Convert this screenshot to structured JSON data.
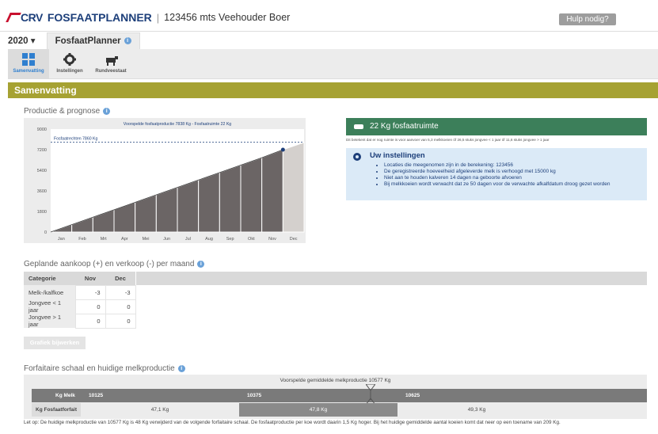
{
  "header": {
    "brand": "CRV",
    "app_name": "FOSFAATPLANNER",
    "separator": "|",
    "customer": "123456  mts Veehouder Boer",
    "help_button": "Hulp nodig?"
  },
  "yearbar": {
    "year": "2020 ▾",
    "tab": "FosfaatPlanner"
  },
  "toolbar": {
    "items": [
      {
        "label": "Samenvatting",
        "icon": "grid-icon"
      },
      {
        "label": "Instellingen",
        "icon": "gear-icon"
      },
      {
        "label": "Rundveestaat",
        "icon": "cow-icon"
      }
    ]
  },
  "section_title": "Samenvatting",
  "production": {
    "title": "Productie & prognose",
    "chart_title": "Voorspelde fosfaatproductie 7838 Kg - Fosfaatruimte 22 Kg",
    "rights_label": "Fosfaatrechten 7860 Kg"
  },
  "chart_data": {
    "type": "area",
    "title": "Voorspelde fosfaatproductie 7838 Kg - Fosfaatruimte 22 Kg",
    "categories": [
      "Jan",
      "Feb",
      "Mrt",
      "Apr",
      "Mei",
      "Jun",
      "Jul",
      "Aug",
      "Sep",
      "Okt",
      "Nov",
      "Dec"
    ],
    "series": [
      {
        "name": "",
        "values": [
          650,
          1300,
          1950,
          2600,
          3250,
          3900,
          4550,
          5200,
          5850,
          6500,
          7200,
          7838
        ]
      }
    ],
    "reference_line": {
      "label": "Fosfaatrechten 7860 Kg",
      "value": 7860
    },
    "y_ticks": [
      0,
      1800,
      3600,
      5400,
      7200,
      9000
    ],
    "ylim": [
      0,
      9000
    ],
    "grid": false,
    "colors": {
      "fill": "#6b6565",
      "future": "#d4d0cd",
      "line": "#1d3f7a",
      "ref": "#1d3f7a"
    }
  },
  "green_card": {
    "text": "22 Kg fosfaatruimte"
  },
  "green_note": "Dit betekent dat er nog ruimte is voor aanvoer van 5,3 melkkoeien óf 26,5 stuks jongvee < 1 jaar óf 11,6 stuks jongvee > 1 jaar",
  "settings": {
    "title": "Uw instellingen",
    "items": [
      "Locaties die meegenomen zijn in de berekening: 123456",
      "De geregistreerde hoeveelheid afgeleverde melk is verhoogd met 15000 kg",
      "Niet aan te houden kalveren 14 dagen na geboorte afvoeren",
      "Bij melkkoeien wordt verwacht dat ze 50 dagen voor de verwachte afkalfdatum droog gezet worden"
    ]
  },
  "planned": {
    "title": "Geplande aankoop (+) en verkoop (-) per maand",
    "columns": [
      "Categorie",
      "Nov",
      "Dec"
    ],
    "rows": [
      [
        "Melk-/kalfkoe",
        "-3",
        "-3"
      ],
      [
        "Jongvee < 1 jaar",
        "0",
        "0"
      ],
      [
        "Jongvee > 1 jaar",
        "0",
        "0"
      ]
    ],
    "button": "Grafiek bijwerken"
  },
  "forfait": {
    "title": "Forfaitaire schaal en huidige melkproductie",
    "predicted": "Voorspelde gemiddelde melkproductie 10577 Kg",
    "kg_melk_label": "Kg Melk",
    "kg_melk_values": [
      "10125",
      "10375",
      "10625"
    ],
    "kg_ff_label": "Kg Fosfaatforfait",
    "kg_ff_values": [
      "47,1 Kg",
      "47,8 Kg",
      "49,3 Kg"
    ],
    "note": "Let op: De huidige melkproductie van 10577 Kg is 48 Kg verwijderd van de volgende forfaitaire schaal. De fosfaatproductie per koe wordt daarin 1,5 Kg hoger. Bij het huidige gemiddelde aantal koeien komt dat neer op een toename van 209 Kg."
  }
}
